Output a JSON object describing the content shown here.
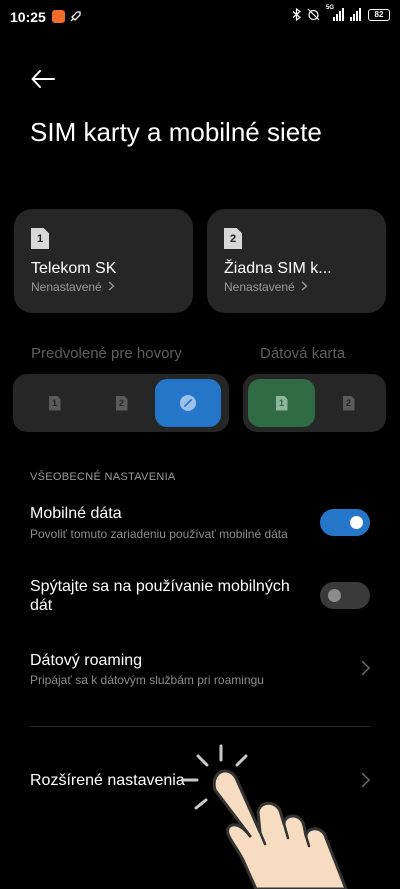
{
  "status_bar": {
    "time": "10:25",
    "battery": "82",
    "network_label": "5G"
  },
  "header": {
    "title": "SIM karty a mobilné siete"
  },
  "sim_cards": [
    {
      "slot": "1",
      "name": "Telekom SK",
      "status": "Nenastavené"
    },
    {
      "slot": "2",
      "name": "Žiadna SIM k...",
      "status": "Nenastavené"
    }
  ],
  "defaults": {
    "calls_label": "Predvolené pre hovory",
    "data_label": "Dátová karta",
    "calls_options": [
      "1",
      "2"
    ],
    "data_options": [
      "1",
      "2"
    ]
  },
  "general": {
    "section_title": "VŠEOBECNÉ NASTAVENIA",
    "mobile_data": {
      "title": "Mobilné dáta",
      "subtitle": "Povoliť tomuto zariadeniu používať mobilné dáta",
      "enabled": true
    },
    "ask_before_data": {
      "title_line1": "Spýtajte sa na používanie mobilných",
      "title_line2": "dát",
      "enabled": false
    },
    "data_roaming": {
      "title": "Dátový roaming",
      "subtitle": "Pripájať sa k dátovým službám pri roamingu"
    },
    "advanced": {
      "title": "Rozšírené nastavenia"
    }
  },
  "colors": {
    "accent_blue": "#2576c8",
    "accent_green": "#2f6b44",
    "card_bg": "#262626"
  }
}
